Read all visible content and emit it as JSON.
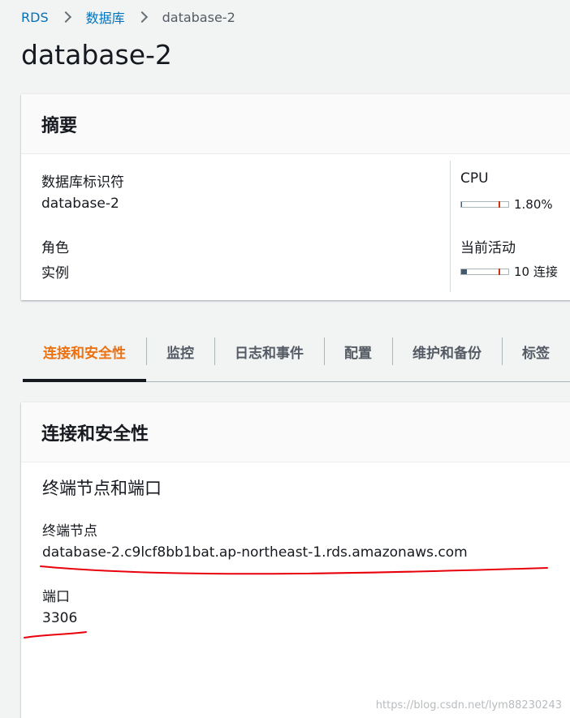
{
  "breadcrumb": {
    "items": [
      {
        "label": "RDS"
      },
      {
        "label": "数据库"
      }
    ],
    "current": "database-2"
  },
  "page_title": "database-2",
  "summary": {
    "title": "摘要",
    "db_identifier_label": "数据库标识符",
    "db_identifier_value": "database-2",
    "role_label": "角色",
    "role_value": "实例",
    "cpu_label": "CPU",
    "cpu_value": "1.80%",
    "cpu_fraction": 0.018,
    "activity_label": "当前活动",
    "activity_value": "10 连接",
    "activity_fraction": 0.12
  },
  "tabs": [
    {
      "label": "连接和安全性",
      "active": true
    },
    {
      "label": "监控",
      "active": false
    },
    {
      "label": "日志和事件",
      "active": false
    },
    {
      "label": "配置",
      "active": false
    },
    {
      "label": "维护和备份",
      "active": false
    },
    {
      "label": "标签",
      "active": false
    }
  ],
  "connectivity": {
    "title": "连接和安全性",
    "section_title": "终端节点和端口",
    "endpoint_label": "终端节点",
    "endpoint_value": "database-2.c9lcf8bb1bat.ap-northeast-1.rds.amazonaws.com",
    "port_label": "端口",
    "port_value": "3306"
  },
  "watermark": "https://blog.csdn.net/lym88230243",
  "colors": {
    "link": "#0073bb",
    "active_tab": "#ec7211",
    "annotation": "#e8000b"
  }
}
